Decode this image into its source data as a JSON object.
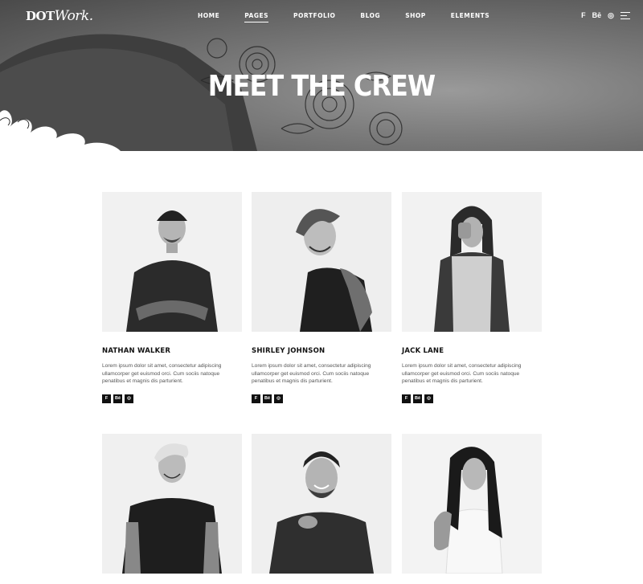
{
  "header": {
    "logo_main": "DOT",
    "logo_script": "Work.",
    "nav": [
      {
        "label": "HOME",
        "active": false
      },
      {
        "label": "PAGES",
        "active": true
      },
      {
        "label": "PORTFOLIO",
        "active": false
      },
      {
        "label": "BLOG",
        "active": false
      },
      {
        "label": "SHOP",
        "active": false
      },
      {
        "label": "ELEMENTS",
        "active": false
      }
    ],
    "icons": [
      "foursquare-icon",
      "behance-icon",
      "instagram-icon",
      "menu-icon"
    ],
    "icon_glyphs": {
      "foursquare": "F",
      "behance": "Bē",
      "instagram": "◎"
    }
  },
  "hero": {
    "title": "MEET THE CREW"
  },
  "team": [
    {
      "name": "NATHAN WALKER",
      "bio": "Lorem ipsum dolor sit amet, consectetur adipiscing ullamcorper get euismod orci. Cum sociis natoque penatibus et magnis dis parturient."
    },
    {
      "name": "SHIRLEY JOHNSON",
      "bio": "Lorem ipsum dolor sit amet, consectetur adipiscing ullamcorper get euismod orci. Cum sociis natoque penatibus et magnis dis parturient."
    },
    {
      "name": "JACK LANE",
      "bio": "Lorem ipsum dolor sit amet, consectetur adipiscing ullamcorper get euismod orci. Cum sociis natoque penatibus et magnis dis parturient."
    },
    {
      "name": "",
      "bio": ""
    },
    {
      "name": "",
      "bio": ""
    },
    {
      "name": "",
      "bio": ""
    }
  ],
  "social_glyphs": [
    "F",
    "Bē",
    "◎"
  ],
  "colors": {
    "accent": "#111111",
    "hero_bg": "#6e6e6e",
    "photo_bg": "#efefef"
  }
}
